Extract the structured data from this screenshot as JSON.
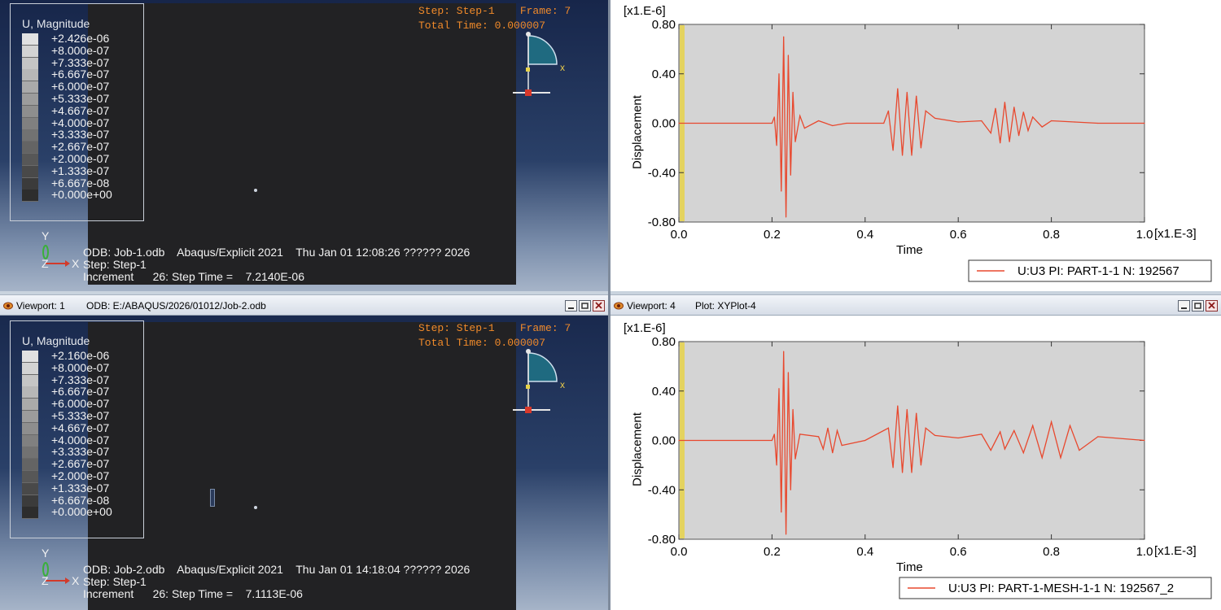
{
  "top_left": {
    "legend": {
      "title": "U, Magnitude",
      "values": [
        "+2.426e-06",
        "+8.000e-07",
        "+7.333e-07",
        "+6.667e-07",
        "+6.000e-07",
        "+5.333e-07",
        "+4.667e-07",
        "+4.000e-07",
        "+3.333e-07",
        "+2.667e-07",
        "+2.000e-07",
        "+1.333e-07",
        "+6.667e-08",
        "+0.000e+00"
      ]
    },
    "step_line1": "Step: Step-1    Frame: 7",
    "step_line2": "Total Time: 0.000007",
    "odb_line": "ODB: Job-1.odb    Abaqus/Explicit 2021    Thu Jan 01 12:08:26 ?????? 2026",
    "step_line": "Step: Step-1",
    "increment_line": "Increment      26: Step Time =    7.2140E-06",
    "triad": {
      "y": "Y",
      "z": "Z",
      "x": "X"
    },
    "mini_axis_x": "x"
  },
  "top_right": {
    "exponent_label": "[x1.E-6]",
    "ylabel": "Displacement",
    "xlabel": "Time",
    "x_exponent": "[x1.E-3]",
    "legend": "U:U3 PI: PART-1-1 N: 192567"
  },
  "bottom_left": {
    "viewport_label": "Viewport: 1",
    "viewport_info": "ODB: E:/ABAQUS/2026/01012/Job-2.odb",
    "legend": {
      "title": "U, Magnitude",
      "values": [
        "+2.160e-06",
        "+8.000e-07",
        "+7.333e-07",
        "+6.667e-07",
        "+6.000e-07",
        "+5.333e-07",
        "+4.667e-07",
        "+4.000e-07",
        "+3.333e-07",
        "+2.667e-07",
        "+2.000e-07",
        "+1.333e-07",
        "+6.667e-08",
        "+0.000e+00"
      ]
    },
    "step_line1": "Step: Step-1    Frame: 7",
    "step_line2": "Total Time: 0.000007",
    "odb_line": "ODB: Job-2.odb    Abaqus/Explicit 2021    Thu Jan 01 14:18:04 ?????? 2026",
    "step_line": "Step: Step-1",
    "increment_line": "Increment      26: Step Time =    7.1113E-06",
    "triad": {
      "y": "Y",
      "z": "Z",
      "x": "X"
    },
    "mini_axis_x": "x"
  },
  "bottom_right": {
    "viewport_label": "Viewport: 4",
    "viewport_info": "Plot: XYPlot-4",
    "exponent_label": "[x1.E-6]",
    "ylabel": "Displacement",
    "xlabel": "Time",
    "x_exponent": "[x1.E-3]",
    "legend": "U:U3 PI: PART-1-MESH-1-1 N: 192567_2"
  },
  "colors": {
    "curve": "#e8482e",
    "plot_bg": "#d4d4d4",
    "marker": "#e6d24a",
    "step_text": "#f08a2a"
  },
  "chart_data": [
    {
      "type": "line",
      "xlabel": "Time",
      "ylabel": "Displacement",
      "xlim": [
        0.0,
        1.0
      ],
      "ylim": [
        -0.8,
        0.8
      ],
      "x_ticks": [
        "0.0",
        "0.2",
        "0.4",
        "0.6",
        "0.8",
        "1.0"
      ],
      "y_ticks": [
        "0.80",
        "0.40",
        "0.00",
        "-0.40",
        "-0.80"
      ],
      "series": [
        {
          "name": "U:U3 PI: PART-1-1 N: 192567",
          "x": [
            0,
            0.2,
            0.205,
            0.21,
            0.215,
            0.22,
            0.225,
            0.23,
            0.235,
            0.24,
            0.245,
            0.25,
            0.26,
            0.27,
            0.3,
            0.33,
            0.36,
            0.44,
            0.45,
            0.46,
            0.47,
            0.48,
            0.49,
            0.5,
            0.51,
            0.52,
            0.53,
            0.55,
            0.6,
            0.65,
            0.67,
            0.68,
            0.69,
            0.7,
            0.71,
            0.72,
            0.73,
            0.74,
            0.75,
            0.76,
            0.78,
            0.8,
            0.85,
            0.9,
            1.0
          ],
          "values": [
            0,
            0,
            0.05,
            -0.18,
            0.4,
            -0.55,
            0.7,
            -0.76,
            0.55,
            -0.42,
            0.25,
            -0.15,
            0.06,
            -0.04,
            0.02,
            -0.02,
            0,
            0,
            0.1,
            -0.22,
            0.28,
            -0.26,
            0.25,
            -0.26,
            0.22,
            -0.2,
            0.1,
            0.04,
            0.01,
            0.02,
            -0.08,
            0.12,
            -0.16,
            0.17,
            -0.15,
            0.13,
            -0.1,
            0.09,
            -0.06,
            0.05,
            -0.03,
            0.02,
            0.01,
            0,
            0
          ]
        }
      ]
    },
    {
      "type": "line",
      "xlabel": "Time",
      "ylabel": "Displacement",
      "xlim": [
        0.0,
        1.0
      ],
      "ylim": [
        -0.8,
        0.8
      ],
      "x_ticks": [
        "0.0",
        "0.2",
        "0.4",
        "0.6",
        "0.8",
        "1.0"
      ],
      "y_ticks": [
        "0.80",
        "0.40",
        "0.00",
        "-0.40",
        "-0.80"
      ],
      "series": [
        {
          "name": "U:U3 PI: PART-1-MESH-1-1 N: 192567_2",
          "x": [
            0,
            0.2,
            0.205,
            0.21,
            0.215,
            0.22,
            0.225,
            0.23,
            0.235,
            0.24,
            0.245,
            0.25,
            0.26,
            0.3,
            0.31,
            0.32,
            0.33,
            0.34,
            0.35,
            0.4,
            0.45,
            0.46,
            0.47,
            0.48,
            0.49,
            0.5,
            0.51,
            0.52,
            0.53,
            0.55,
            0.6,
            0.65,
            0.67,
            0.69,
            0.7,
            0.72,
            0.74,
            0.76,
            0.78,
            0.8,
            0.82,
            0.84,
            0.86,
            0.9,
            1.0
          ],
          "values": [
            0,
            0,
            0.05,
            -0.2,
            0.42,
            -0.58,
            0.72,
            -0.76,
            0.55,
            -0.4,
            0.25,
            -0.15,
            0.05,
            0.03,
            -0.07,
            0.1,
            -0.1,
            0.08,
            -0.04,
            0,
            0.1,
            -0.22,
            0.28,
            -0.26,
            0.25,
            -0.26,
            0.22,
            -0.2,
            0.1,
            0.04,
            0.02,
            0.05,
            -0.08,
            0.07,
            -0.07,
            0.08,
            -0.1,
            0.12,
            -0.14,
            0.15,
            -0.14,
            0.12,
            -0.08,
            0.03,
            0
          ]
        }
      ]
    }
  ]
}
